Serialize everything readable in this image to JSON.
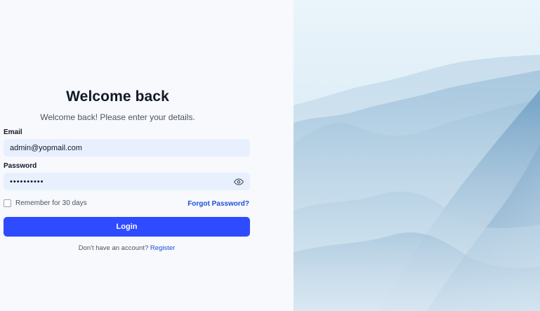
{
  "login": {
    "title": "Welcome back",
    "subtitle": "Welcome back! Please enter your details.",
    "email_label": "Email",
    "email_value": "admin@yopmail.com",
    "password_label": "Password",
    "password_masked": "••••••••••",
    "remember_label": "Remember for 30 days",
    "remember_checked": false,
    "forgot_label": "Forgot Password?",
    "login_label": "Login",
    "no_account_text": "Don't have an account?",
    "register_label": "Register"
  },
  "icons": {
    "password_toggle": "eye-icon"
  },
  "colors": {
    "primary": "#2f4bff",
    "link": "#1d4ed8",
    "input_bg": "#e8f0fe",
    "page_bg": "#f7f9fc"
  }
}
